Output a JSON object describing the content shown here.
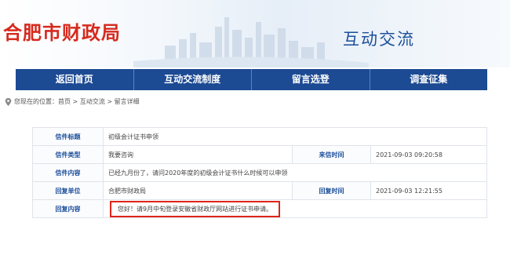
{
  "header": {
    "site_title": "合肥市财政局",
    "section_title": "互动交流"
  },
  "nav": {
    "items": [
      {
        "label": "返回首页"
      },
      {
        "label": "互动交流制度"
      },
      {
        "label": "留言选登"
      },
      {
        "label": "调查征集"
      }
    ]
  },
  "breadcrumb": {
    "text": "您现在的位置：首页 > 互动交流 > 留言详细",
    "icon": "location-pin-icon"
  },
  "letter": {
    "title_label": "信件标题",
    "title_value": "初级会计证书申领",
    "type_label": "信件类型",
    "type_value": "我要咨询",
    "received_label": "来信时间",
    "received_value": "2021-09-03 09:20:58",
    "content_label": "信件内容",
    "content_value": "已经九月份了，请问2020年度的初级会计证书什么时候可以申领",
    "reply_unit_label": "回复单位",
    "reply_unit_value": "合肥市财政局",
    "reply_time_label": "回复时间",
    "reply_time_value": "2021-09-03 12:21:55",
    "reply_content_label": "回复内容",
    "reply_content_value": "您好！请9月中旬登录安徽省财政厅网站进行证书申请。"
  },
  "colors": {
    "brand_red": "#d62a1e",
    "nav_blue": "#1c4a93",
    "label_blue": "#1d4f9a",
    "highlight_red": "#e0241b"
  }
}
